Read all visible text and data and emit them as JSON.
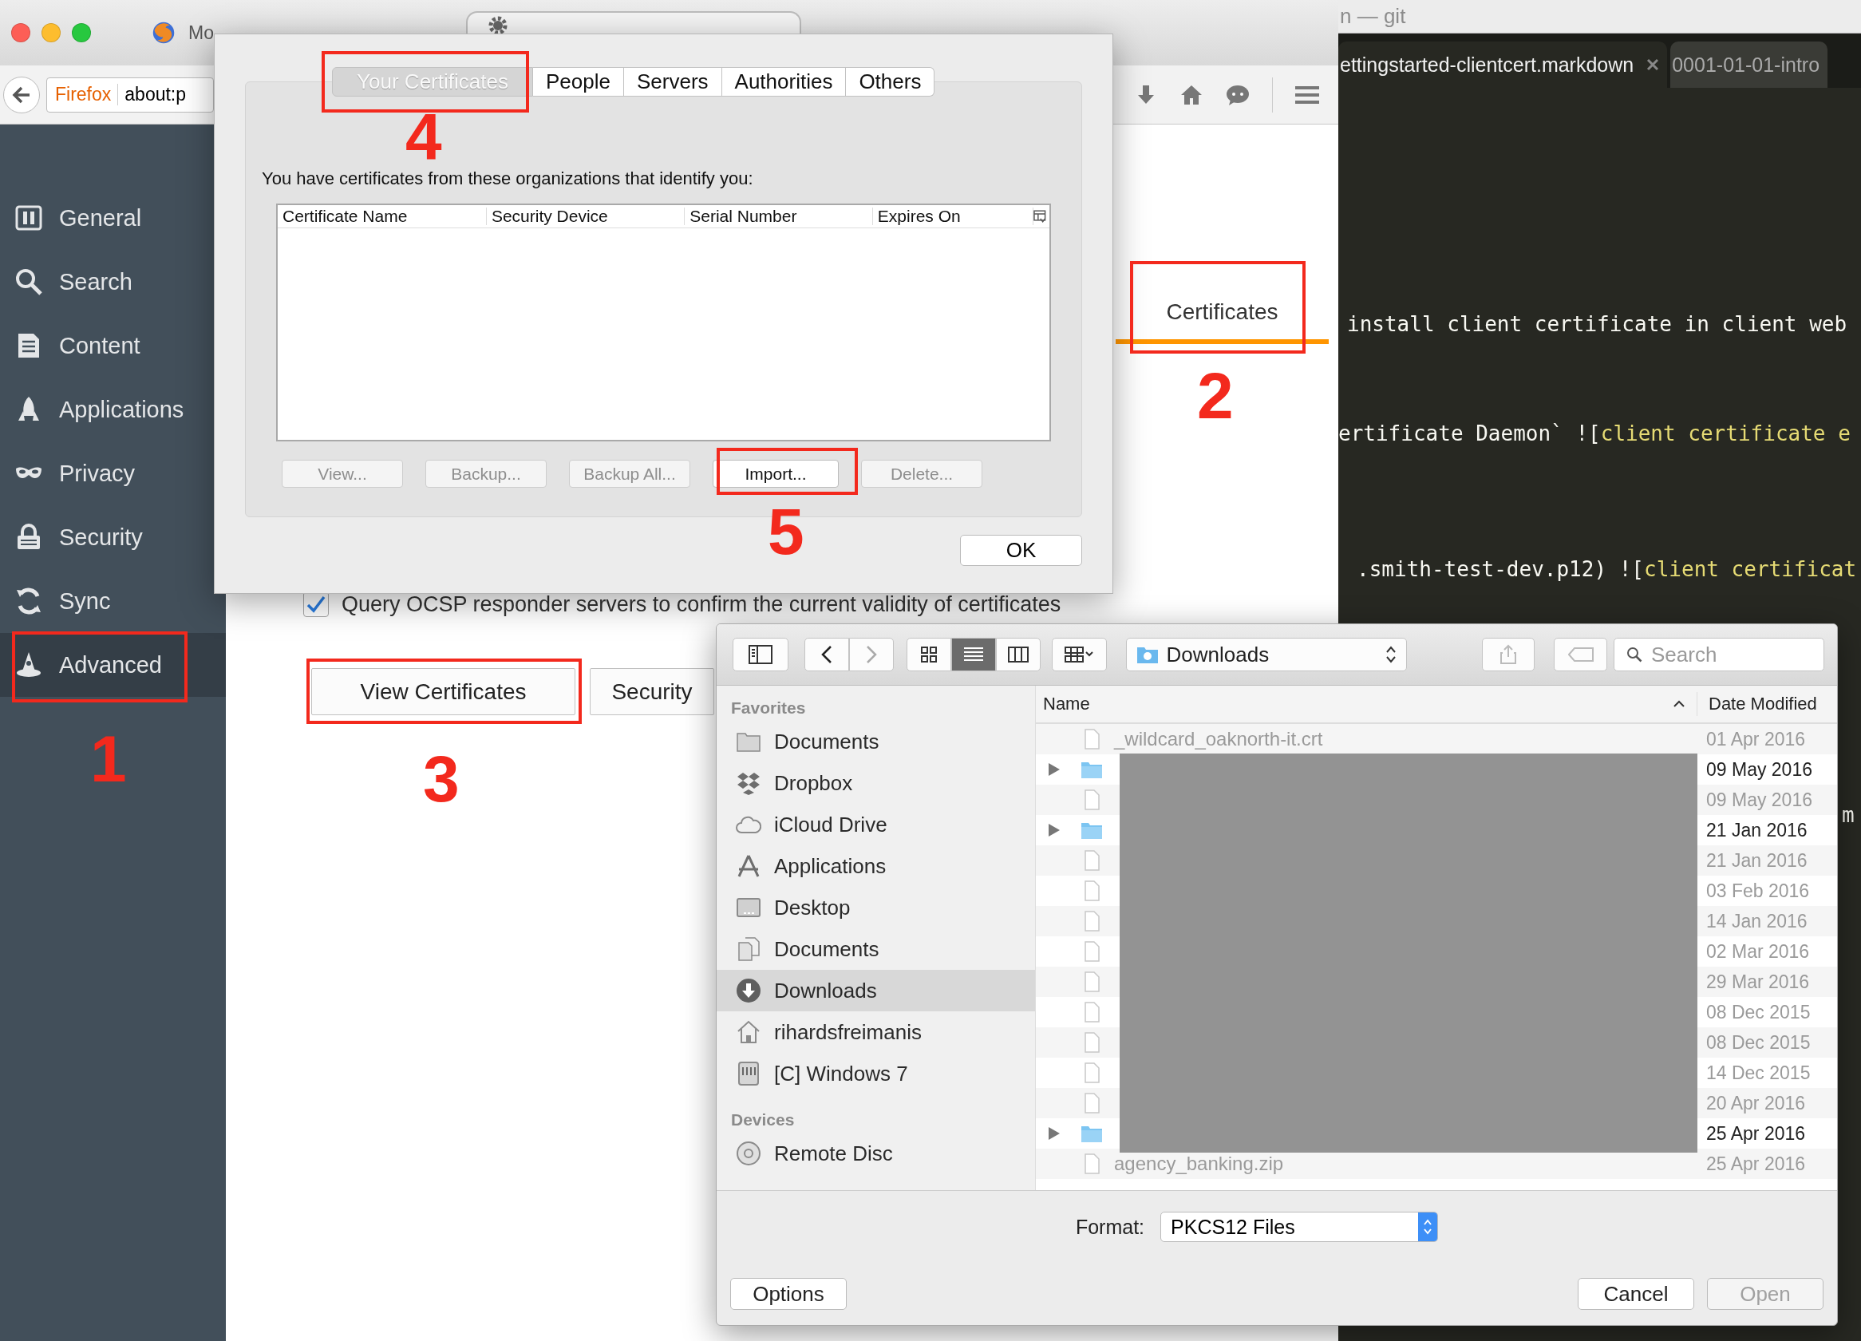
{
  "browser": {
    "tabs": [
      {
        "title": "Mo",
        "selected": false
      },
      {
        "selected": true
      }
    ],
    "address_bar": {
      "identity": "Firefox",
      "url": "about:p"
    },
    "sidebar": [
      {
        "label": "General",
        "selected": false
      },
      {
        "label": "Search",
        "selected": false
      },
      {
        "label": "Content",
        "selected": false
      },
      {
        "label": "Applications",
        "selected": false
      },
      {
        "label": "Privacy",
        "selected": false
      },
      {
        "label": "Security",
        "selected": false
      },
      {
        "label": "Sync",
        "selected": false
      },
      {
        "label": "Advanced",
        "selected": true
      }
    ],
    "content": {
      "tab": "Certificates",
      "ocsp": {
        "label": "Query OCSP responder servers to confirm the current validity of certificates",
        "checked": true
      },
      "buttons": [
        "View Certificates",
        "Security"
      ]
    }
  },
  "editor": {
    "title": "n — git",
    "tabs": [
      {
        "title": "ettingstarted-clientcert.markdown",
        "selected": true
      },
      {
        "title": "0001-01-01-intro",
        "selected": false
      }
    ],
    "lines": [
      {
        "segments": [
          {
            "text": "install client certificate in client web",
            "kind": "plain"
          }
        ]
      },
      {
        "segments": [
          {
            "text": "ertificate Daemon` ![",
            "kind": "plain"
          },
          {
            "text": "client certificate e",
            "kind": "link"
          }
        ]
      },
      {
        "segments": [
          {
            "text": ".smith-test-dev.p12) ![",
            "kind": "plain"
          },
          {
            "text": "client certificat",
            "kind": "link"
          }
        ]
      },
      {
        "segments": [
          {
            "text": "m",
            "kind": "plain"
          }
        ]
      }
    ]
  },
  "cert_dialog": {
    "tabs": [
      {
        "label": "Your Certificates",
        "selected": true
      },
      {
        "label": "People",
        "selected": false
      },
      {
        "label": "Servers",
        "selected": false
      },
      {
        "label": "Authorities",
        "selected": false
      },
      {
        "label": "Others",
        "selected": false
      }
    ],
    "intro": "You have certificates from these organizations that identify you:",
    "columns": [
      "Certificate Name",
      "Security Device",
      "Serial Number",
      "Expires On"
    ],
    "buttons": [
      {
        "label": "View...",
        "disabled": true
      },
      {
        "label": "Backup...",
        "disabled": true
      },
      {
        "label": "Backup All...",
        "disabled": true
      },
      {
        "label": "Import...",
        "disabled": false
      },
      {
        "label": "Delete...",
        "disabled": true
      }
    ],
    "ok": "OK"
  },
  "file_dialog": {
    "view_modes": [
      {
        "selected": false
      },
      {
        "selected": true
      },
      {
        "selected": false
      }
    ],
    "location": "Downloads",
    "search_placeholder": "Search",
    "sidebar": [
      {
        "title": "Favorites",
        "items": [
          {
            "label": "Documents",
            "selected": false
          },
          {
            "label": "Dropbox",
            "selected": false
          },
          {
            "label": "iCloud Drive",
            "selected": false
          },
          {
            "label": "Applications",
            "selected": false
          },
          {
            "label": "Desktop",
            "selected": false
          },
          {
            "label": "Documents",
            "selected": false
          },
          {
            "label": "Downloads",
            "selected": true
          },
          {
            "label": "rihardsfreimanis",
            "selected": false
          },
          {
            "label": "[C] Windows 7",
            "selected": false
          }
        ]
      },
      {
        "title": "Devices",
        "items": [
          {
            "label": "Remote Disc",
            "selected": false
          }
        ]
      }
    ],
    "columns": [
      "Name",
      "Date Modified"
    ],
    "rows": [
      {
        "kind": "file",
        "name": "_wildcard_oaknorth-it.crt",
        "date": "01 Apr 2016"
      },
      {
        "kind": "folder",
        "expanded": false,
        "date": "09 May 2016"
      },
      {
        "kind": "file",
        "date": "09 May 2016"
      },
      {
        "kind": "folder",
        "expanded": false,
        "date": "21 Jan 2016"
      },
      {
        "kind": "file",
        "date": "21 Jan 2016"
      },
      {
        "kind": "file",
        "date": "03 Feb 2016"
      },
      {
        "kind": "file",
        "date": "14 Jan 2016"
      },
      {
        "kind": "file",
        "date": "02 Mar 2016"
      },
      {
        "kind": "file",
        "date": "29 Mar 2016"
      },
      {
        "kind": "file",
        "date": "08 Dec 2015"
      },
      {
        "kind": "file",
        "date": "08 Dec 2015"
      },
      {
        "kind": "file",
        "date": "14 Dec 2015"
      },
      {
        "kind": "file",
        "date": "20 Apr 2016"
      },
      {
        "kind": "folder",
        "expanded": false,
        "date": "25 Apr 2016"
      },
      {
        "kind": "file",
        "name": "agency_banking.zip",
        "date": "25 Apr 2016"
      }
    ],
    "format_label": "Format:",
    "format": "PKCS12 Files",
    "buttons": [
      {
        "label": "Options",
        "disabled": false
      },
      {
        "label": "Cancel",
        "disabled": false
      },
      {
        "label": "Open",
        "disabled": true
      }
    ]
  },
  "annotations": [
    "1",
    "2",
    "3",
    "4",
    "5"
  ]
}
